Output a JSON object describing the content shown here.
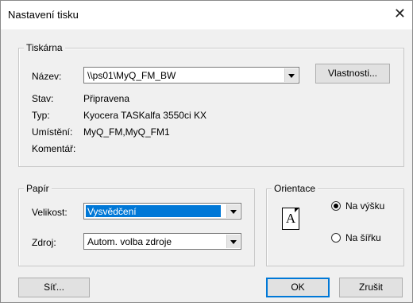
{
  "dialog": {
    "title": "Nastavení tisku"
  },
  "printer_group": {
    "legend": "Tiskárna",
    "name_label": "Název:",
    "name_value": "\\\\ps01\\MyQ_FM_BW",
    "properties_button": "Vlastnosti...",
    "status_label": "Stav:",
    "status_value": "Připravena",
    "type_label": "Typ:",
    "type_value": "Kyocera TASKalfa 3550ci KX",
    "location_label": "Umístění:",
    "location_value": "MyQ_FM,MyQ_FM1",
    "comment_label": "Komentář:"
  },
  "paper_group": {
    "legend": "Papír",
    "size_label": "Velikost:",
    "size_value": "Vysvědčení",
    "source_label": "Zdroj:",
    "source_value": "Autom. volba zdroje"
  },
  "orientation_group": {
    "legend": "Orientace",
    "icon_letter": "A",
    "portrait_label": "Na výšku",
    "landscape_label": "Na šířku",
    "selected": "portrait"
  },
  "buttons": {
    "network": "Síť...",
    "ok": "OK",
    "cancel": "Zrušit"
  },
  "colors": {
    "accent": "#0078d7",
    "background": "#f0f0f0"
  }
}
